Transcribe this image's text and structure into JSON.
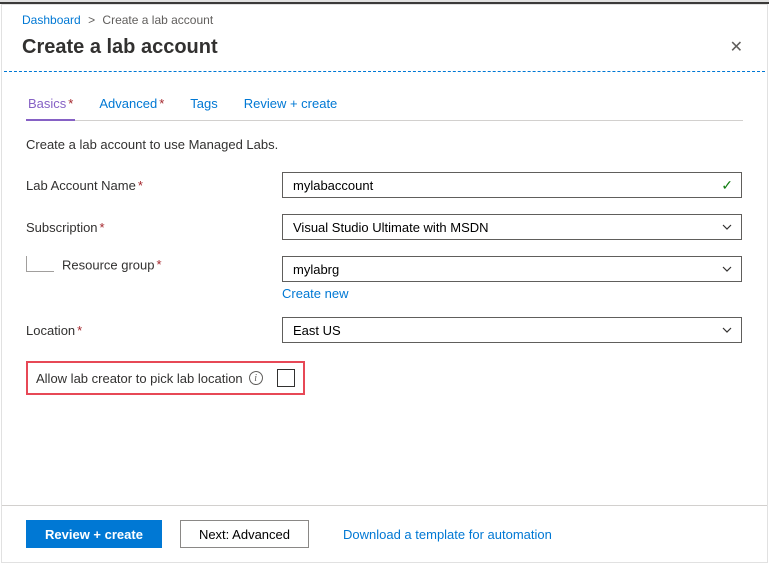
{
  "breadcrumb": {
    "root": "Dashboard",
    "current": "Create a lab account"
  },
  "title": "Create a lab account",
  "tabs": {
    "basics": "Basics",
    "advanced": "Advanced",
    "tags": "Tags",
    "review": "Review + create"
  },
  "description": "Create a lab account to use Managed Labs.",
  "labels": {
    "labAccountName": "Lab Account Name",
    "subscription": "Subscription",
    "resourceGroup": "Resource group",
    "location": "Location",
    "allowPick": "Allow lab creator to pick lab location"
  },
  "values": {
    "labAccountName": "mylabaccount",
    "subscription": "Visual Studio Ultimate with MSDN",
    "resourceGroup": "mylabrg",
    "location": "East US"
  },
  "links": {
    "createNew": "Create new",
    "downloadTemplate": "Download a template for automation"
  },
  "buttons": {
    "review": "Review + create",
    "next": "Next: Advanced"
  }
}
